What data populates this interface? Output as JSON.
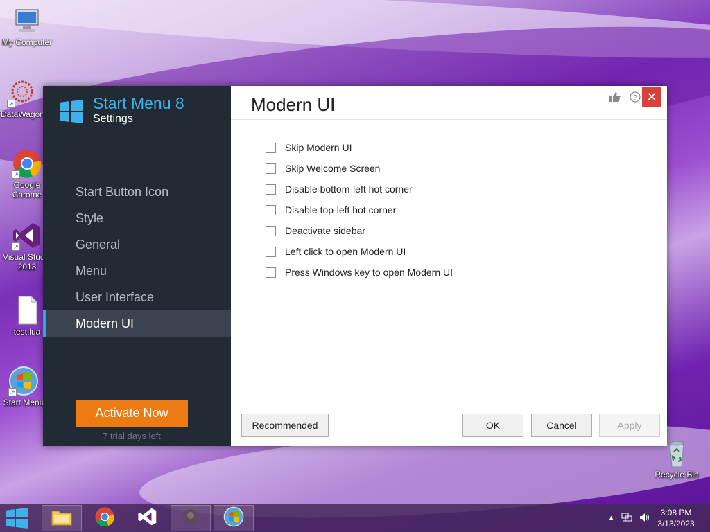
{
  "desktop": {
    "icons": [
      {
        "label": "My Computer"
      },
      {
        "label": "DataWagon"
      },
      {
        "label": "Google Chrome"
      },
      {
        "label": "Visual Studio 2013"
      },
      {
        "label": "test.lua"
      },
      {
        "label": "Start Menu"
      },
      {
        "label": "Recycle Bin"
      }
    ]
  },
  "window": {
    "app_title": "Start Menu 8",
    "app_subtitle": "Settings",
    "nav": [
      {
        "label": "Start Button Icon"
      },
      {
        "label": "Style"
      },
      {
        "label": "General"
      },
      {
        "label": "Menu"
      },
      {
        "label": "User Interface"
      },
      {
        "label": "Modern UI",
        "active": true
      }
    ],
    "activate_label": "Activate Now",
    "trial_text": "7 trial days left",
    "page_title": "Modern UI",
    "close_glyph": "✕",
    "options": [
      {
        "label": "Skip Modern UI",
        "checked": false
      },
      {
        "label": "Skip Welcome Screen",
        "checked": false
      },
      {
        "label": "Disable bottom-left hot corner",
        "checked": false
      },
      {
        "label": "Disable top-left hot corner",
        "checked": false
      },
      {
        "label": "Deactivate sidebar",
        "checked": false
      },
      {
        "label": "Left click to open Modern UI",
        "checked": false
      },
      {
        "label": "Press Windows key to open Modern UI",
        "checked": false
      }
    ],
    "buttons": {
      "recommended": "Recommended",
      "ok": "OK",
      "cancel": "Cancel",
      "apply": "Apply"
    }
  },
  "taskbar": {
    "clock_time": "3:08 PM",
    "clock_date": "3/13/2023",
    "tray_arrow": "▲"
  },
  "colors": {
    "accent": "#3fb0e8",
    "activate": "#ee7a12",
    "sidebar_bg": "#222a34",
    "close_red": "#d9403a"
  }
}
